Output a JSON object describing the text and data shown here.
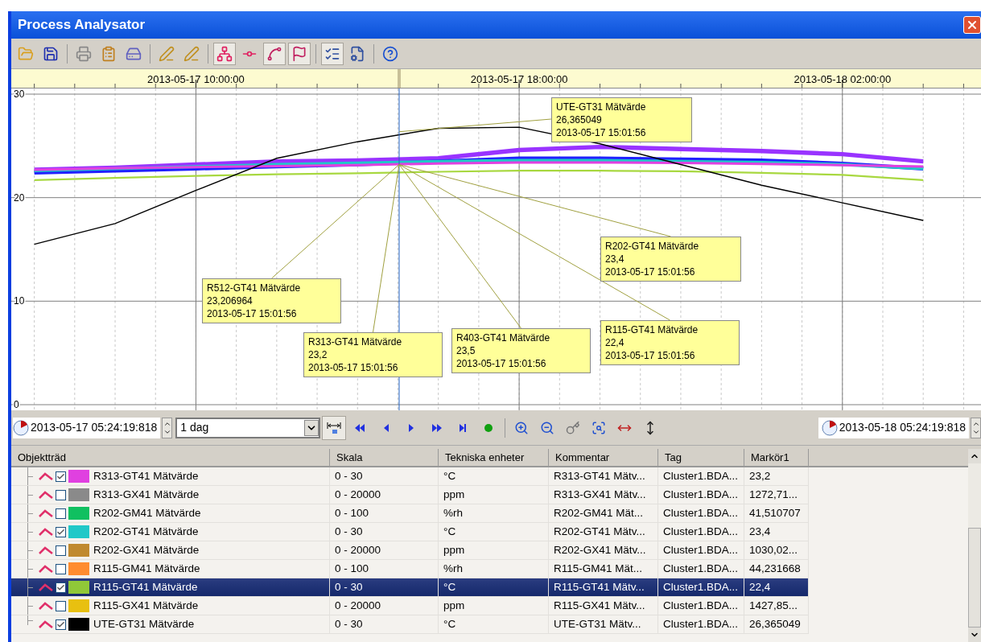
{
  "window": {
    "title": "Process Analysator"
  },
  "toolbar": [
    {
      "kind": "open",
      "pressed": false
    },
    {
      "kind": "save",
      "pressed": false
    },
    {
      "kind": "separator"
    },
    {
      "kind": "print",
      "pressed": false
    },
    {
      "kind": "clipboard",
      "pressed": false
    },
    {
      "kind": "save-chart",
      "pressed": false
    },
    {
      "kind": "separator"
    },
    {
      "kind": "pen-add",
      "pressed": false
    },
    {
      "kind": "pen-remove",
      "pressed": false
    },
    {
      "kind": "separator"
    },
    {
      "kind": "nodes",
      "pressed": true
    },
    {
      "kind": "line-point",
      "pressed": false
    },
    {
      "kind": "cursor",
      "pressed": true
    },
    {
      "kind": "cursor-flag",
      "pressed": true
    },
    {
      "kind": "separator"
    },
    {
      "kind": "list-chart",
      "pressed": true
    },
    {
      "kind": "properties",
      "pressed": false
    },
    {
      "kind": "separator"
    },
    {
      "kind": "help",
      "pressed": false
    }
  ],
  "chart": {
    "cursor": {
      "level": 0.4
    },
    "chart_data": {
      "type": "line",
      "grid": true,
      "ylim": [
        0,
        30
      ],
      "yticks": [
        0,
        10,
        20,
        30
      ],
      "categories": [
        null,
        null,
        "2013-05-17 10:00:00",
        null,
        null,
        null,
        "2013-05-17 18:00:00",
        null,
        null,
        null,
        "2013-05-18 02:00:00",
        null
      ],
      "series": [
        {
          "name": "R403-GT41 Mätvärde",
          "color": "#9933ff",
          "values": [
            22.7,
            22.9,
            23.2,
            23.5,
            23.6,
            23.8,
            24.6,
            24.9,
            24.7,
            24.5,
            24.2,
            23.5
          ]
        },
        {
          "name": "R512-GT41 Mätvärde",
          "color": "#2020ff",
          "values": [
            22.4,
            22.6,
            22.8,
            23.0,
            23.2,
            23.5,
            23.8,
            23.8,
            23.7,
            23.6,
            23.3,
            22.8
          ]
        },
        {
          "name": "R202-GT41 Mätvärde",
          "color": "#20c8c8",
          "values": [
            22.6,
            22.8,
            23.0,
            23.2,
            23.35,
            23.5,
            23.6,
            23.6,
            23.5,
            23.4,
            23.2,
            22.8
          ]
        },
        {
          "name": "R313-GT41 Mätvärde",
          "color": "#e040e0",
          "values": [
            22.7,
            22.85,
            22.95,
            23.05,
            23.15,
            23.3,
            23.4,
            23.4,
            23.35,
            23.25,
            23.15,
            23.0
          ]
        },
        {
          "name": "R115-GT41 Mätvärde",
          "color": "#a8d840",
          "values": [
            21.7,
            21.9,
            22.1,
            22.25,
            22.35,
            22.5,
            22.6,
            22.6,
            22.55,
            22.4,
            22.2,
            21.7
          ]
        },
        {
          "name": "UTE-GT31 Mätvärde",
          "color": "#000000",
          "values": [
            15.5,
            17.5,
            20.7,
            23.8,
            25.4,
            26.7,
            26.8,
            25.2,
            23.2,
            21.2,
            19.5,
            17.8
          ]
        }
      ],
      "annotations": [
        "23,5\n2013-05-17 15:01:56",
        "23,206964\n2013-05-17 15:01:56",
        "23,4\n2013-05-17 15:01:56",
        "23,2\n2013-05-17 15:01:56",
        "22,4\n2013-05-17 15:01:56",
        "26,365049\n2013-05-17 15:01:56"
      ]
    }
  },
  "range": {
    "start": "2013-05-17 05:24:19:818",
    "span": "1 dag",
    "end": "2013-05-18 05:24:19:818"
  },
  "nav": [
    {
      "kind": "fit-lock",
      "pressed": true
    },
    {
      "kind": "first",
      "pressed": false
    },
    {
      "kind": "prev",
      "pressed": false
    },
    {
      "kind": "next",
      "pressed": false
    },
    {
      "kind": "forward",
      "pressed": false
    },
    {
      "kind": "last",
      "pressed": false
    },
    {
      "kind": "live",
      "pressed": false
    },
    {
      "kind": "separator"
    },
    {
      "kind": "zoom-in",
      "pressed": false
    },
    {
      "kind": "zoom-out",
      "pressed": false
    },
    {
      "kind": "key",
      "pressed": false
    },
    {
      "kind": "zoom-rect",
      "pressed": false
    },
    {
      "kind": "fit-x",
      "pressed": false
    },
    {
      "kind": "fit-y",
      "pressed": false
    }
  ],
  "table": {
    "columns": [
      "Objektträd",
      "Skala",
      "Tekniska enheter",
      "Kommentar",
      "Tag",
      "Markör1"
    ],
    "rows": [
      {
        "name": "R313-GT41 Mätvärde",
        "scale": "0 - 30",
        "unit": "°C",
        "comment": "R313-GT41 Mätv...",
        "tag": "Cluster1.BDA...",
        "marker": "23,2",
        "checked": true,
        "color": "#e040e0",
        "selected": false
      },
      {
        "name": "R313-GX41 Mätvärde",
        "scale": "0 - 20000",
        "unit": "ppm",
        "comment": "R313-GX41 Mätv...",
        "tag": "Cluster1.BDA...",
        "marker": "1272,71...",
        "checked": false,
        "color": "#8a8a8a",
        "selected": false
      },
      {
        "name": "R202-GM41 Mätvärde",
        "scale": "0 - 100",
        "unit": "%rh",
        "comment": "R202-GM41 Mät...",
        "tag": "Cluster1.BDA...",
        "marker": "41,510707",
        "checked": false,
        "color": "#10c060",
        "selected": false
      },
      {
        "name": "R202-GT41 Mätvärde",
        "scale": "0 - 30",
        "unit": "°C",
        "comment": "R202-GT41 Mätv...",
        "tag": "Cluster1.BDA...",
        "marker": "23,4",
        "checked": true,
        "color": "#20c8c8",
        "selected": false
      },
      {
        "name": "R202-GX41 Mätvärde",
        "scale": "0 - 20000",
        "unit": "ppm",
        "comment": "R202-GX41 Mätv...",
        "tag": "Cluster1.BDA...",
        "marker": "1030,02...",
        "checked": false,
        "color": "#c08a30",
        "selected": false
      },
      {
        "name": "R115-GM41 Mätvärde",
        "scale": "0 - 100",
        "unit": "%rh",
        "comment": "R115-GM41 Mät...",
        "tag": "Cluster1.BDA...",
        "marker": "44,231668",
        "checked": false,
        "color": "#ff8c30",
        "selected": false
      },
      {
        "name": "R115-GT41 Mätvärde",
        "scale": "0 - 30",
        "unit": "°C",
        "comment": "R115-GT41 Mätv...",
        "tag": "Cluster1.BDA...",
        "marker": "22,4",
        "checked": true,
        "color": "#90c838",
        "selected": true
      },
      {
        "name": "R115-GX41 Mätvärde",
        "scale": "0 - 20000",
        "unit": "ppm",
        "comment": "R115-GX41 Mätv...",
        "tag": "Cluster1.BDA...",
        "marker": "1427,85...",
        "checked": false,
        "color": "#e8c010",
        "selected": false
      },
      {
        "name": "UTE-GT31 Mätvärde",
        "scale": "0 - 30",
        "unit": "°C",
        "comment": "UTE-GT31 Mätv...",
        "tag": "Cluster1.BDA...",
        "marker": "26,365049",
        "checked": true,
        "color": "#000000",
        "selected": false
      }
    ]
  }
}
